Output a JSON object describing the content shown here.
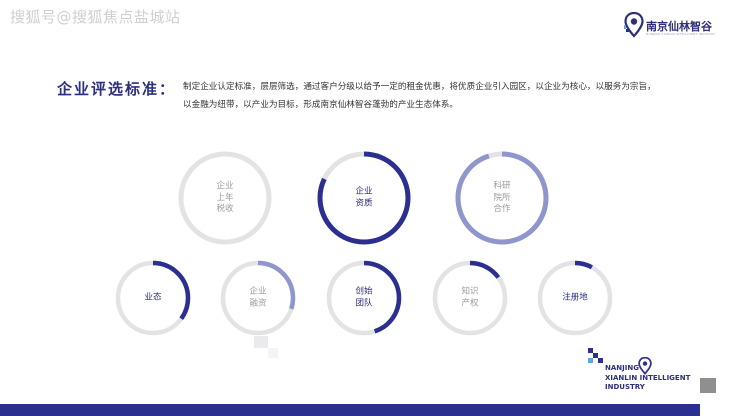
{
  "watermark": "搜狐号@搜狐焦点盐城站",
  "logo": {
    "name": "南京仙林智谷",
    "subtitle": "NANJING XIANLIN INTELLIGENT INDUSTRY",
    "icon": "location-pin-icon"
  },
  "heading": "企业评选标准：",
  "description": "制定企业认定标准，层层筛选，通过客户分级以给予一定的租金优惠，将优质企业引入园区，以企业为核心，以服务为宗旨，以金融为纽带，以产业为目标，形成南京仙林智谷蓬勃的产业生态体系。",
  "colors": {
    "dark": "#2b2f8f",
    "mid": "#8e96cc",
    "track": "#e3e3e6",
    "text_dark": "#2b2f7e",
    "text_gray": "#9b9b9b"
  },
  "circles": [
    {
      "label": "企业\n上年\n税收",
      "level": 0.0,
      "style": "gray"
    },
    {
      "label": "企业\n资质",
      "level": 0.82,
      "style": "dark"
    },
    {
      "label": "科研\n院所\n合作",
      "level": 0.95,
      "style": "mid"
    },
    {
      "label": "业态",
      "level": 0.35,
      "style": "dark"
    },
    {
      "label": "企业\n融资",
      "level": 0.3,
      "style": "mid"
    },
    {
      "label": "创始\n团队",
      "level": 0.45,
      "style": "dark"
    },
    {
      "label": "知识\n产权",
      "level": 0.15,
      "style": "gray"
    },
    {
      "label": "注册地",
      "level": 0.08,
      "style": "dark"
    }
  ],
  "footer": {
    "text": "NANJING\nXIANLIN  INTELLIGENT\nINDUSTRY"
  }
}
